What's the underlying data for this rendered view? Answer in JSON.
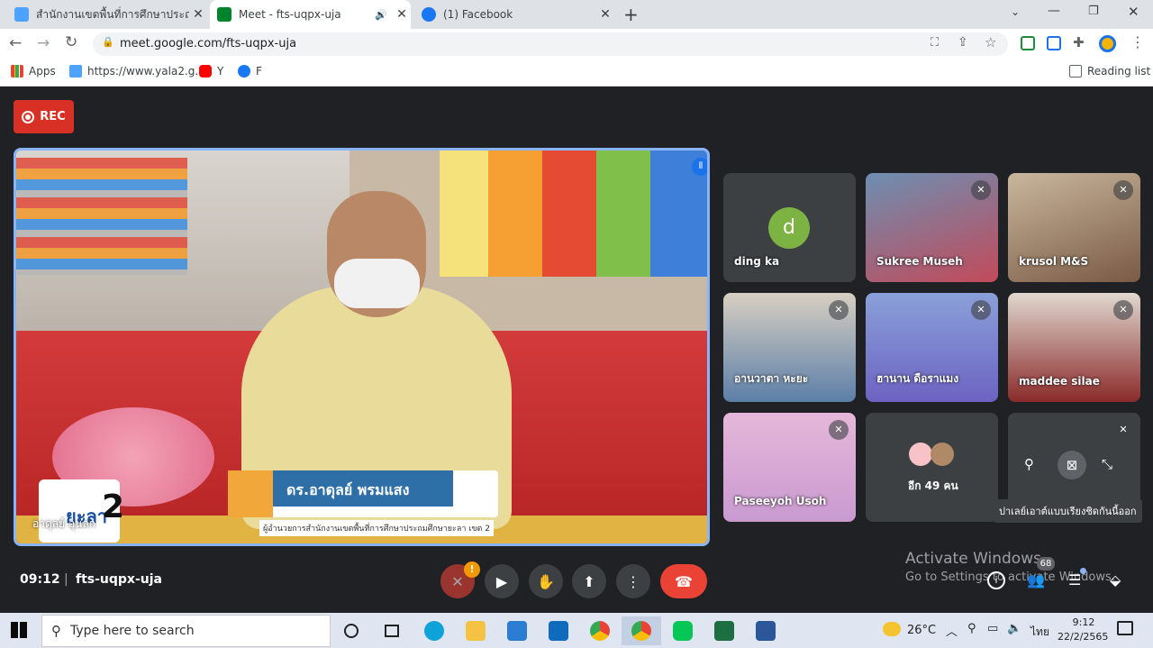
{
  "tabs": [
    {
      "title": "สำนักงานเขตพื้นที่การศึกษาประถมศึกษ",
      "color": "#1a73e8"
    },
    {
      "title": "Meet - fts-uqpx-uja",
      "color": "#00832d"
    },
    {
      "title": "(1) Facebook",
      "color": "#1877f2"
    }
  ],
  "address": {
    "url": "meet.google.com/fts-uqpx-uja"
  },
  "bookmarks": [
    "Apps",
    "https://www.yala2.g...",
    "Y",
    "F"
  ],
  "reading_list": "Reading list",
  "rec_label": "REC",
  "main_video": {
    "name_banner": "ดร.อาดุลย์ พรมแสง",
    "subtitle": "ผู้อำนวยการสำนักงานเขตพื้นที่การศึกษาประถมศึกษายะลา เขต 2",
    "logo_text": "ยะลา",
    "logo_num": "2",
    "speaker_name": "อาดุลย์ อุนลก"
  },
  "tiles": [
    {
      "name": "ding ka",
      "avatar": "d",
      "muted": false
    },
    {
      "name": "Sukree Museh",
      "muted": true
    },
    {
      "name": "krusol M&S",
      "muted": true
    },
    {
      "name": "อานวาตา หะยะ",
      "muted": true
    },
    {
      "name": "ฮานาน ดือราแมง",
      "muted": true
    },
    {
      "name": "maddee silae",
      "muted": true
    },
    {
      "name": "Paseeyoh Usoh",
      "muted": true
    },
    {
      "name": "อีก 49 คน",
      "muted": false
    },
    {
      "name": "",
      "muted": true
    }
  ],
  "tooltip": "ปาเลย์เอาต์แบบเรียงชิดกันนี้ออก",
  "meeting": {
    "time": "09:12",
    "code": "fts-uqpx-uja"
  },
  "activate": {
    "title": "Activate Windows",
    "sub": "Go to Settings to activate Windows."
  },
  "people_count": "68",
  "taskbar": {
    "search": "Type here to search",
    "temp": "26°C",
    "lang": "ไทย",
    "time": "9:12",
    "date": "22/2/2565"
  }
}
